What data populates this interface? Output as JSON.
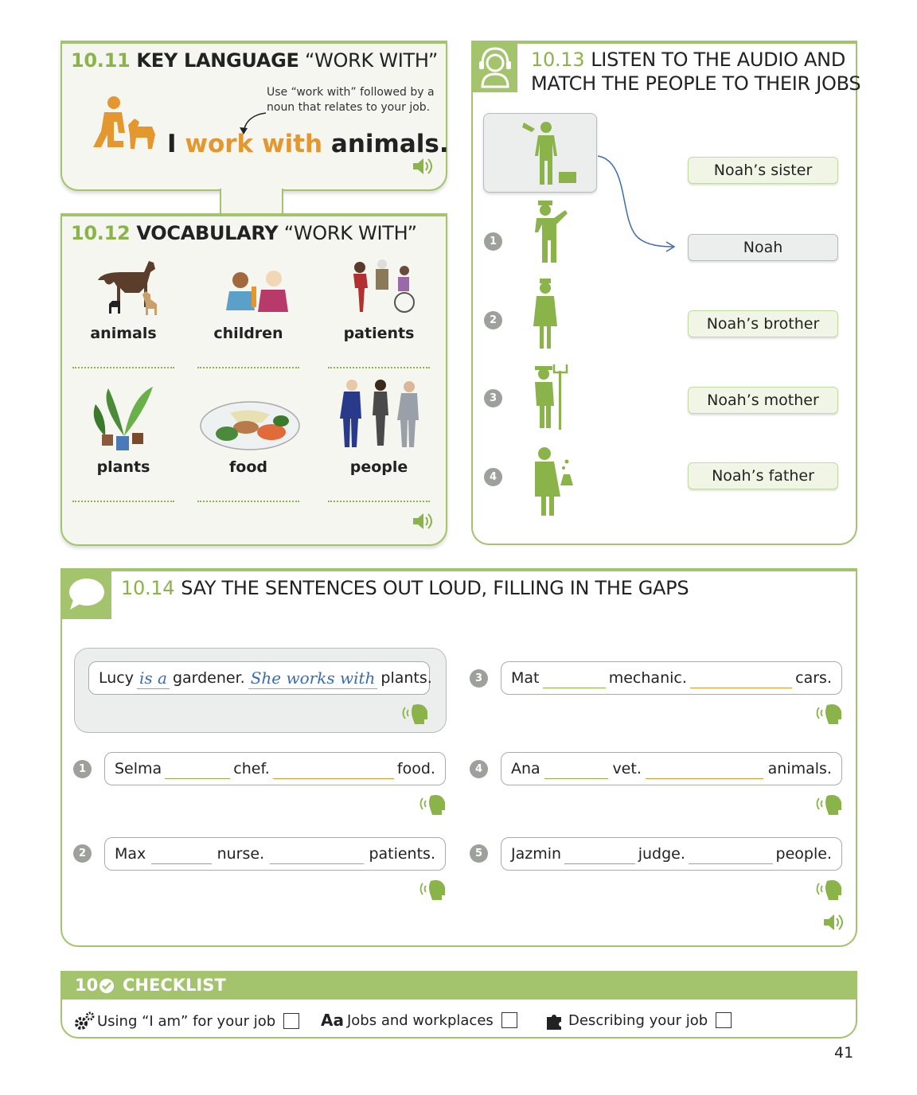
{
  "key_language": {
    "number": "10.11",
    "title_bold": "KEY LANGUAGE",
    "title_rest": "“WORK WITH”",
    "note": "Use “work with” followed by a noun that relates to your job.",
    "sentence_start": "I ",
    "sentence_highlight": "work with",
    "sentence_end": " animals."
  },
  "vocabulary": {
    "number": "10.12",
    "title_bold": "VOCABULARY",
    "title_rest": "“WORK WITH”",
    "items": [
      {
        "label": "animals",
        "icon": "animals-icon"
      },
      {
        "label": "children",
        "icon": "children-icon"
      },
      {
        "label": "patients",
        "icon": "patients-icon"
      },
      {
        "label": "plants",
        "icon": "plants-icon"
      },
      {
        "label": "food",
        "icon": "food-icon"
      },
      {
        "label": "people",
        "icon": "people-icon"
      }
    ]
  },
  "listen": {
    "number": "10.13",
    "title_line1": "LISTEN TO THE AUDIO AND",
    "title_line2": "MATCH THE PEOPLE TO THEIR JOBS",
    "answers": [
      "Noah’s sister",
      "Noah",
      "Noah’s brother",
      "Noah’s mother",
      "Noah’s father"
    ],
    "numbers": [
      "1",
      "2",
      "3",
      "4"
    ]
  },
  "speaking": {
    "number": "10.14",
    "title": "SAY THE SENTENCES OUT LOUD, FILLING IN THE GAPS",
    "example": {
      "subject": "Lucy",
      "fill1": "is a",
      "job": "gardener.",
      "fill2": "She works with",
      "object": "plants."
    },
    "sentences": [
      {
        "num": "1",
        "subject": "Selma",
        "job": "chef.",
        "object": "food."
      },
      {
        "num": "2",
        "subject": "Max",
        "job": "nurse.",
        "object": "patients."
      },
      {
        "num": "3",
        "subject": "Mat",
        "job": "mechanic.",
        "object": "cars."
      },
      {
        "num": "4",
        "subject": "Ana",
        "job": "vet.",
        "object": "animals."
      },
      {
        "num": "5",
        "subject": "Jazmin",
        "job": "judge.",
        "object": "people."
      }
    ]
  },
  "checklist": {
    "number": "10",
    "title": "CHECKLIST",
    "items": [
      "Using “I am” for your job",
      "Jobs and workplaces",
      "Describing your job"
    ],
    "aa": "Aa"
  },
  "page_number": "41",
  "colors": {
    "accent": "#a3c46c",
    "orange": "#e4962f",
    "handwriting": "#3a6bb5"
  }
}
